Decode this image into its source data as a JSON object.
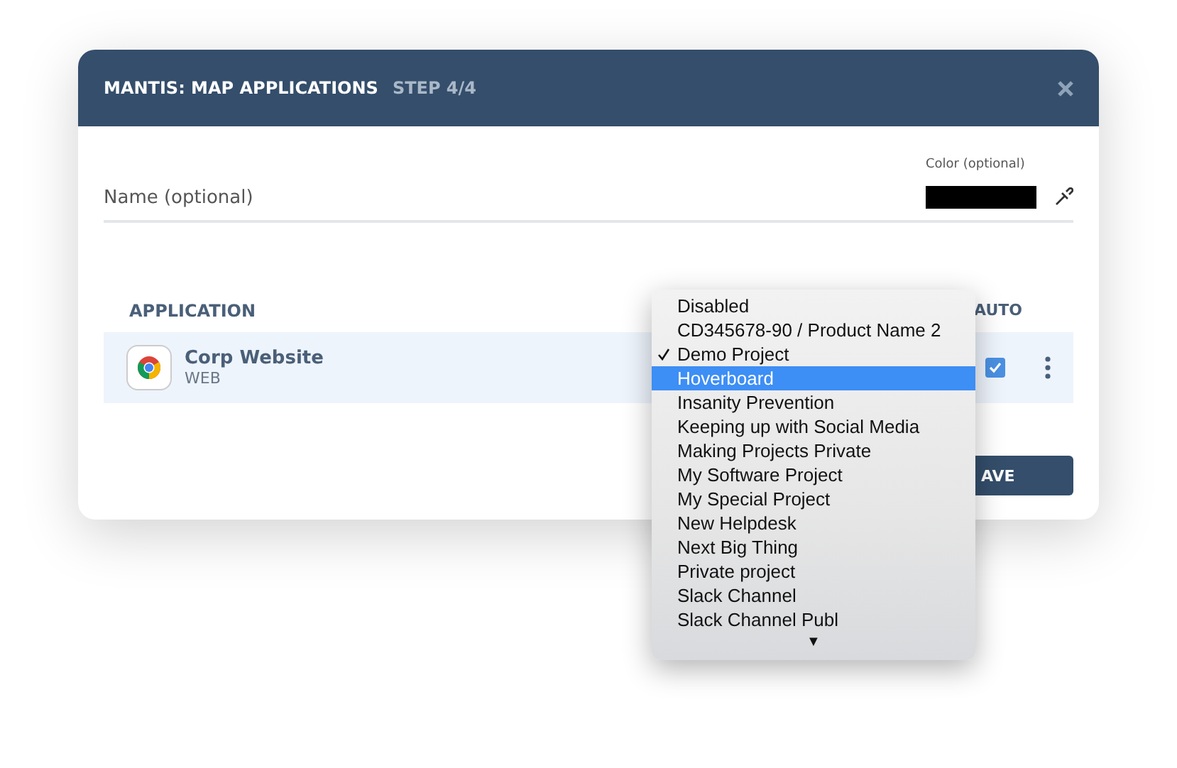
{
  "dialog": {
    "title": "MANTIS: MAP APPLICATIONS",
    "step": "STEP 4/4"
  },
  "name_field": {
    "placeholder": "Name (optional)"
  },
  "color_field": {
    "label": "Color (optional)",
    "color": "#000000"
  },
  "table": {
    "columns": [
      {
        "label": "APPLICATION"
      },
      {
        "label": "AUTO"
      }
    ],
    "rows": [
      {
        "name": "Corp Website",
        "type": "WEB",
        "auto": true
      }
    ]
  },
  "save_button": "AVE",
  "dropdown": {
    "items": [
      {
        "label": "Disabled",
        "checked": false,
        "highlighted": false
      },
      {
        "label": "CD345678-90 / Product Name 2",
        "checked": false,
        "highlighted": false
      },
      {
        "label": "Demo Project",
        "checked": true,
        "highlighted": false
      },
      {
        "label": "Hoverboard",
        "checked": false,
        "highlighted": true
      },
      {
        "label": "Insanity Prevention",
        "checked": false,
        "highlighted": false
      },
      {
        "label": "Keeping up with Social Media",
        "checked": false,
        "highlighted": false
      },
      {
        "label": "Making Projects Private",
        "checked": false,
        "highlighted": false
      },
      {
        "label": "My Software Project",
        "checked": false,
        "highlighted": false
      },
      {
        "label": "My Special Project",
        "checked": false,
        "highlighted": false
      },
      {
        "label": "New Helpdesk",
        "checked": false,
        "highlighted": false
      },
      {
        "label": "Next Big Thing",
        "checked": false,
        "highlighted": false
      },
      {
        "label": "Private project",
        "checked": false,
        "highlighted": false
      },
      {
        "label": "Slack Channel",
        "checked": false,
        "highlighted": false
      },
      {
        "label": "Slack Channel Publ",
        "checked": false,
        "highlighted": false
      }
    ],
    "more_arrow": "▼"
  }
}
